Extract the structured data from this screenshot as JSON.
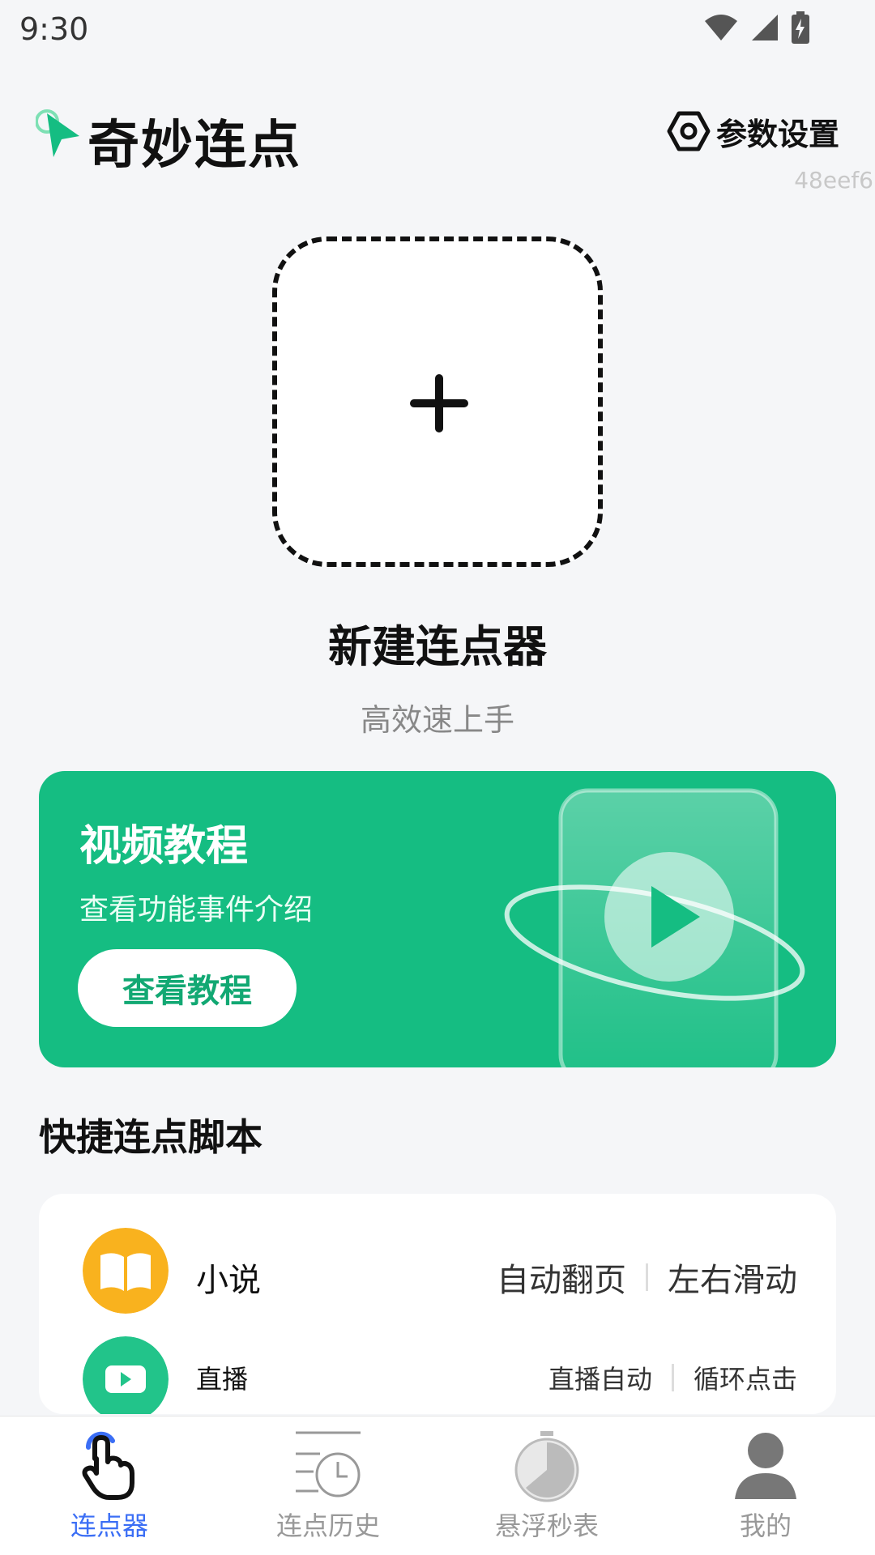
{
  "status_bar": {
    "time": "9:30"
  },
  "header": {
    "app_title": "奇妙连点",
    "settings_label": "参数设置",
    "build_tag": "48eef6"
  },
  "new_clicker": {
    "title": "新建连点器",
    "subtitle": "高效速上手"
  },
  "video_banner": {
    "title": "视频教程",
    "description": "查看功能事件介绍",
    "button_label": "查看教程"
  },
  "section": {
    "title": "快捷连点脚本"
  },
  "scripts": [
    {
      "name": "小说",
      "tags": [
        "自动翻页",
        "左右滑动"
      ],
      "icon": "book-icon",
      "color": "#f9b21e"
    },
    {
      "name": "直播",
      "tags": [
        "直播自动",
        "循环点击"
      ],
      "icon": "play-icon",
      "color": "#22c48a"
    }
  ],
  "tabs": [
    {
      "label": "连点器",
      "icon": "tap-hand-icon",
      "active": true
    },
    {
      "label": "连点历史",
      "icon": "history-icon",
      "active": false
    },
    {
      "label": "悬浮秒表",
      "icon": "stopwatch-icon",
      "active": false
    },
    {
      "label": "我的",
      "icon": "user-icon",
      "active": false
    }
  ],
  "colors": {
    "brand_green": "#15bd82",
    "active_tab": "#3b6ef5",
    "background": "#f5f6f8"
  }
}
